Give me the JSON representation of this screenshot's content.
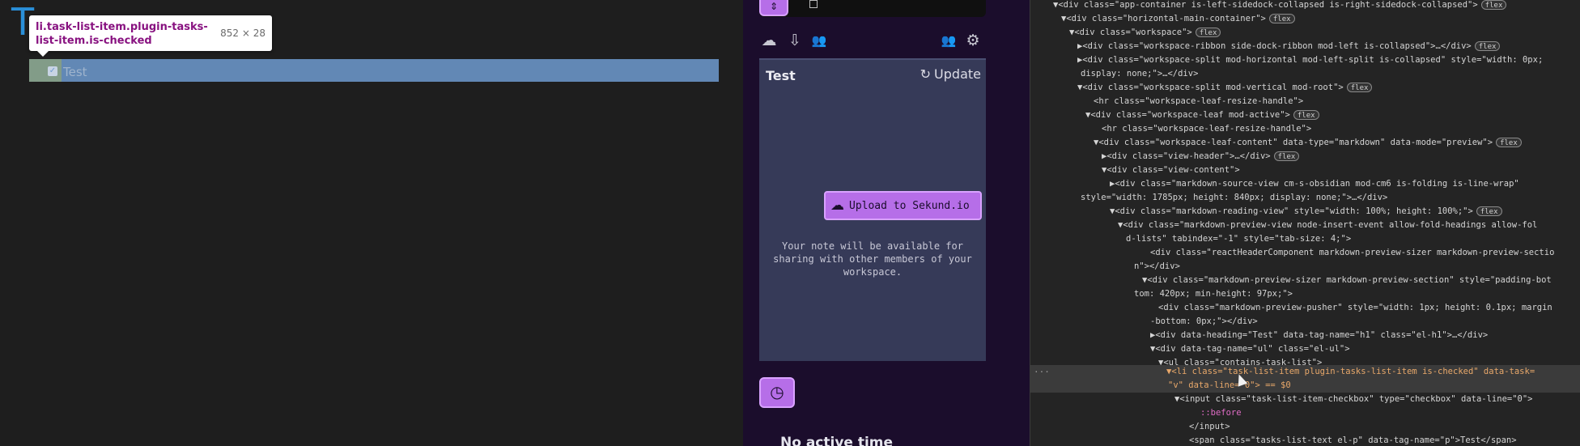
{
  "editor": {
    "heading_fragment": "T",
    "tooltip": {
      "element_name": "li.task-list-item.plugin-tasks-list-item.is-checked",
      "element_size": "852 × 28"
    },
    "task": {
      "text": "Test",
      "checked": true,
      "checkbox_glyph": "✓"
    },
    "colors": {
      "highlight": "#6e9bd0",
      "padding_highlight": "#9dad63",
      "heading": "#2a8fd8"
    }
  },
  "panel": {
    "top_button_icon": "pin-icon",
    "top_button_glyph": "⇕",
    "toolbar_icons": [
      {
        "name": "cloud-upload-icon",
        "glyph": "☁"
      },
      {
        "name": "cloud-download-icon",
        "glyph": "⇩"
      },
      {
        "name": "people-icon",
        "glyph": "👥"
      },
      {
        "name": "group-icon",
        "glyph": "👥"
      },
      {
        "name": "gear-icon",
        "glyph": "⚙"
      }
    ],
    "card": {
      "title": "Test",
      "update_label": "Update",
      "update_glyph": "↻",
      "upload_label": "Upload to Sekund.io",
      "upload_glyph": "☁",
      "note": "Your note will be available for sharing with other members of your workspace."
    },
    "clock_glyph": "◷",
    "no_active_time": "No active time",
    "colors": {
      "accent": "#b66ee8",
      "accent_border": "#d9a2ff",
      "card_bg": "#363a58",
      "panel_bg": "#1b0d2c"
    }
  },
  "devtools": {
    "flex_label": "flex",
    "lines": [
      {
        "code": "▼<div class=\"app-container is-left-sidedock-collapsed is-right-sidedock-collapsed\">",
        "flex": true
      },
      {
        "code": "▼<div class=\"horizontal-main-container\">",
        "flex": true
      },
      {
        "code": "▼<div class=\"workspace\">",
        "flex": true
      },
      {
        "code": "▶<div class=\"workspace-ribbon side-dock-ribbon mod-left is-collapsed\">…</div>",
        "flex": true
      },
      {
        "code": "▶<div class=\"workspace-split mod-horizontal mod-left-split is-collapsed\" style=\"width: 0px;",
        "flex": false
      },
      {
        "code": "display: none;\">…</div>",
        "flex": false
      },
      {
        "code": "▼<div class=\"workspace-split mod-vertical mod-root\">",
        "flex": true
      },
      {
        "code": "<hr class=\"workspace-leaf-resize-handle\">",
        "flex": false
      },
      {
        "code": "▼<div class=\"workspace-leaf mod-active\">",
        "flex": true
      },
      {
        "code": "<hr class=\"workspace-leaf-resize-handle\">",
        "flex": false
      },
      {
        "code": "▼<div class=\"workspace-leaf-content\" data-type=\"markdown\" data-mode=\"preview\">",
        "flex": true
      },
      {
        "code": "▶<div class=\"view-header\">…</div>",
        "flex": true
      },
      {
        "code": "▼<div class=\"view-content\">",
        "flex": false
      },
      {
        "code": "▶<div class=\"markdown-source-view cm-s-obsidian mod-cm6 is-folding is-line-wrap\"",
        "flex": false
      },
      {
        "code": "style=\"width: 1785px; height: 840px; display: none;\">…</div>",
        "flex": false
      },
      {
        "code": "▼<div class=\"markdown-reading-view\" style=\"width: 100%; height: 100%;\">",
        "flex": true
      },
      {
        "code": "▼<div class=\"markdown-preview-view node-insert-event allow-fold-headings allow-fol",
        "flex": false
      },
      {
        "code": "d-lists\" tabindex=\"-1\" style=\"tab-size: 4;\">",
        "flex": false
      },
      {
        "code": "<div class=\"reactHeaderComponent markdown-preview-sizer markdown-preview-sectio",
        "flex": false
      },
      {
        "code": "n\"></div>",
        "flex": false
      },
      {
        "code": "▼<div class=\"markdown-preview-sizer markdown-preview-section\" style=\"padding-bot",
        "flex": false
      },
      {
        "code": "tom: 420px; min-height: 97px;\">",
        "flex": false
      },
      {
        "code": "<div class=\"markdown-preview-pusher\" style=\"width: 1px; height: 0.1px; margin",
        "flex": false
      },
      {
        "code": "-bottom: 0px;\"></div>",
        "flex": false
      },
      {
        "code": "▶<div data-heading=\"Test\" data-tag-name=\"h1\" class=\"el-h1\">…</div>",
        "flex": false
      },
      {
        "code": "▼<div data-tag-name=\"ul\" class=\"el-ul\">",
        "flex": false
      },
      {
        "code": "▼<ul class=\"contains-task-list\">",
        "flex": false
      },
      {
        "code": "▼<li class=\"task-list-item plugin-tasks-list-item is-checked\" data-task=",
        "flex": false
      },
      {
        "code": "\"v\" data-line=\"0\"> == $0",
        "flex": false
      },
      {
        "code": "▼<input class=\"task-list-item-checkbox\" type=\"checkbox\" data-line=\"0\">",
        "flex": false
      },
      {
        "code": "::before",
        "flex": false
      },
      {
        "code": "</input>",
        "flex": false
      },
      {
        "code": "<span class=\"tasks-list-text el-p\" data-tag-name=\"p\">Test</span>",
        "flex": false
      }
    ]
  }
}
